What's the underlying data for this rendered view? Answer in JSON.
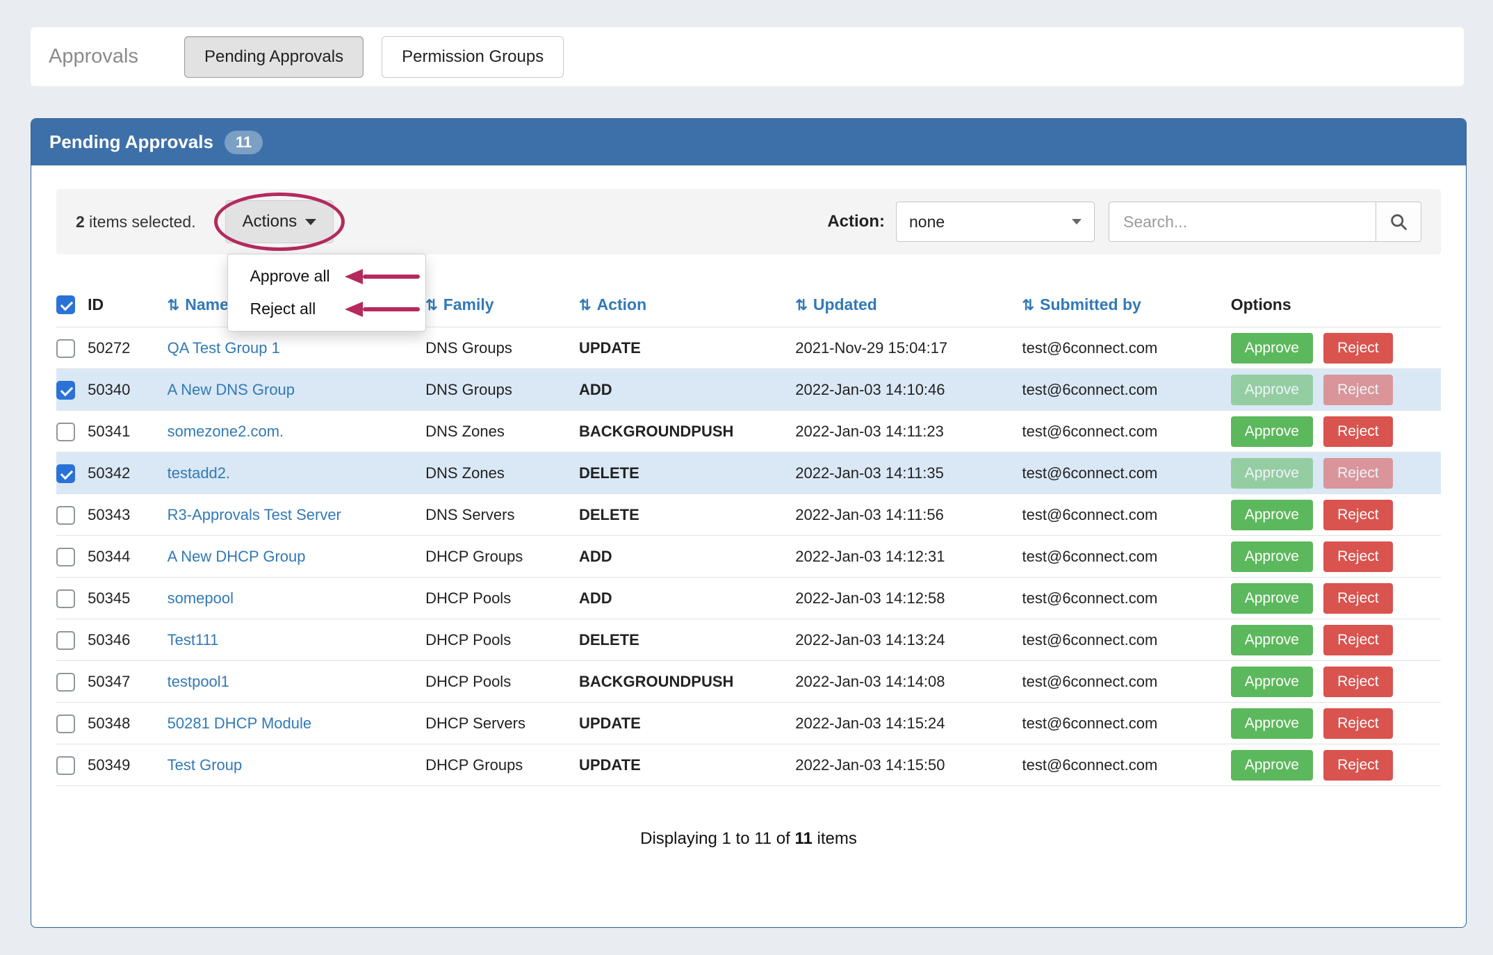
{
  "page": {
    "title": "Approvals",
    "tabs": [
      {
        "label": "Pending Approvals",
        "active": true
      },
      {
        "label": "Permission Groups",
        "active": false
      }
    ]
  },
  "panel": {
    "title": "Pending Approvals",
    "count_badge": "11"
  },
  "toolbar": {
    "selected_count": "2",
    "selected_suffix": " items selected.",
    "actions_button": "Actions",
    "action_label": "Action:",
    "action_value": "none",
    "search_placeholder": "Search..."
  },
  "actions_menu": {
    "items": [
      "Approve all",
      "Reject all"
    ]
  },
  "annotations": {
    "color": "#b42a5d",
    "ellipse_target": "actions-button",
    "arrow_targets": [
      "menu-item-approve-all",
      "menu-item-reject-all"
    ]
  },
  "table": {
    "sort_icon": "⇅",
    "headers": [
      {
        "label": "ID",
        "sortable": false
      },
      {
        "label": "Name",
        "sortable": true
      },
      {
        "label": "Family",
        "sortable": true
      },
      {
        "label": "Action",
        "sortable": true
      },
      {
        "label": "Updated",
        "sortable": true
      },
      {
        "label": "Submitted by",
        "sortable": true
      },
      {
        "label": "Options",
        "sortable": false
      }
    ],
    "select_all_checked": true,
    "options": {
      "approve_label": "Approve",
      "reject_label": "Reject"
    },
    "rows": [
      {
        "id": "50272",
        "name": "QA Test Group 1",
        "family": "DNS Groups",
        "action": "UPDATE",
        "updated": "2021-Nov-29 15:04:17",
        "submitted_by": "test@6connect.com",
        "checked": false
      },
      {
        "id": "50340",
        "name": "A New DNS Group",
        "family": "DNS Groups",
        "action": "ADD",
        "updated": "2022-Jan-03 14:10:46",
        "submitted_by": "test@6connect.com",
        "checked": true
      },
      {
        "id": "50341",
        "name": "somezone2.com.",
        "family": "DNS Zones",
        "action": "BACKGROUNDPUSH",
        "updated": "2022-Jan-03 14:11:23",
        "submitted_by": "test@6connect.com",
        "checked": false
      },
      {
        "id": "50342",
        "name": "testadd2.",
        "family": "DNS Zones",
        "action": "DELETE",
        "updated": "2022-Jan-03 14:11:35",
        "submitted_by": "test@6connect.com",
        "checked": true
      },
      {
        "id": "50343",
        "name": "R3-Approvals Test Server",
        "family": "DNS Servers",
        "action": "DELETE",
        "updated": "2022-Jan-03 14:11:56",
        "submitted_by": "test@6connect.com",
        "checked": false
      },
      {
        "id": "50344",
        "name": "A New DHCP Group",
        "family": "DHCP Groups",
        "action": "ADD",
        "updated": "2022-Jan-03 14:12:31",
        "submitted_by": "test@6connect.com",
        "checked": false
      },
      {
        "id": "50345",
        "name": "somepool",
        "family": "DHCP Pools",
        "action": "ADD",
        "updated": "2022-Jan-03 14:12:58",
        "submitted_by": "test@6connect.com",
        "checked": false
      },
      {
        "id": "50346",
        "name": "Test111",
        "family": "DHCP Pools",
        "action": "DELETE",
        "updated": "2022-Jan-03 14:13:24",
        "submitted_by": "test@6connect.com",
        "checked": false
      },
      {
        "id": "50347",
        "name": "testpool1",
        "family": "DHCP Pools",
        "action": "BACKGROUNDPUSH",
        "updated": "2022-Jan-03 14:14:08",
        "submitted_by": "test@6connect.com",
        "checked": false
      },
      {
        "id": "50348",
        "name": "50281 DHCP Module",
        "family": "DHCP Servers",
        "action": "UPDATE",
        "updated": "2022-Jan-03 14:15:24",
        "submitted_by": "test@6connect.com",
        "checked": false
      },
      {
        "id": "50349",
        "name": "Test Group",
        "family": "DHCP Groups",
        "action": "UPDATE",
        "updated": "2022-Jan-03 14:15:50",
        "submitted_by": "test@6connect.com",
        "checked": false
      }
    ]
  },
  "footer": {
    "prefix": "Displaying 1 to 11 of ",
    "count": "11",
    "suffix": " items"
  }
}
